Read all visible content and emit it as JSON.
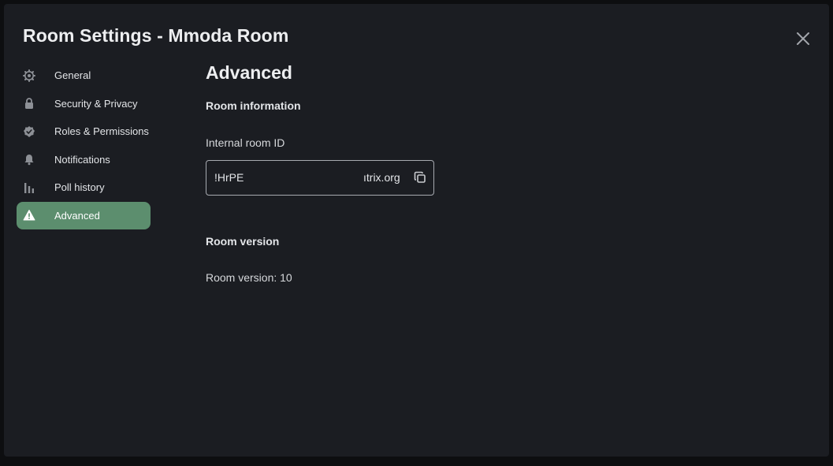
{
  "dialog": {
    "title": "Room Settings - Mmoda Room",
    "close_icon": "close-icon"
  },
  "sidebar": {
    "items": [
      {
        "label": "General",
        "icon": "gear-icon",
        "active": false
      },
      {
        "label": "Security & Privacy",
        "icon": "lock-icon",
        "active": false
      },
      {
        "label": "Roles & Permissions",
        "icon": "shield-check-icon",
        "active": false
      },
      {
        "label": "Notifications",
        "icon": "bell-icon",
        "active": false
      },
      {
        "label": "Poll history",
        "icon": "bar-chart-icon",
        "active": false
      },
      {
        "label": "Advanced",
        "icon": "warning-icon",
        "active": true
      }
    ]
  },
  "main": {
    "heading": "Advanced",
    "room_information": {
      "heading": "Room information",
      "id_label": "Internal room ID",
      "id_value_start": "!HrPE",
      "id_value_end": "ıtrix.org",
      "copy_icon": "copy-icon"
    },
    "room_version": {
      "heading": "Room version",
      "text": "Room version: 10"
    }
  },
  "colors": {
    "active_nav": "#5c8e6e",
    "dialog_bg": "#1b1d22",
    "backdrop": "#0d0e10"
  }
}
